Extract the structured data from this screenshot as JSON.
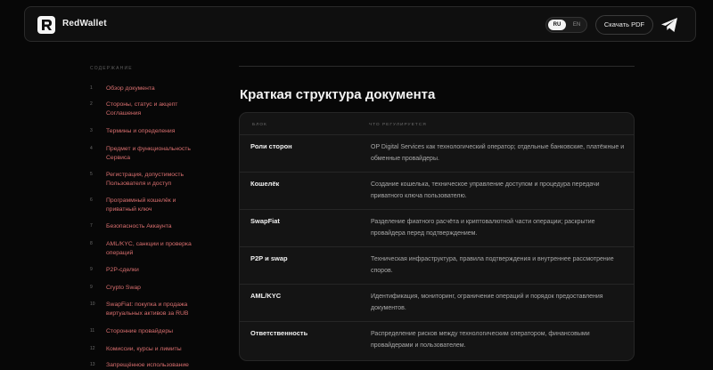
{
  "header": {
    "brand": "RedWallet",
    "lang_ru": "RU",
    "lang_en": "EN",
    "pdf_label": "Скачать PDF"
  },
  "sidebar": {
    "title": "СОДЕРЖАНИЕ",
    "items": [
      {
        "num": "1",
        "label": "Обзор документа"
      },
      {
        "num": "2",
        "label": "Стороны, статус и акцепт Соглашения"
      },
      {
        "num": "3",
        "label": "Термины и определения"
      },
      {
        "num": "4",
        "label": "Предмет и функциональность Сервиса"
      },
      {
        "num": "5",
        "label": "Регистрация, допустимость Пользователя и доступ"
      },
      {
        "num": "6",
        "label": "Программный кошелёк и приватный ключ"
      },
      {
        "num": "7",
        "label": "Безопасность Аккаунта"
      },
      {
        "num": "8",
        "label": "AML/KYC, санкции и проверка операций"
      },
      {
        "num": "9",
        "label": "P2P-сделки"
      },
      {
        "num": "9",
        "label": "Crypto Swap"
      },
      {
        "num": "10",
        "label": "SwapFiat: покупка и продажа виртуальных активов за RUB"
      },
      {
        "num": "11",
        "label": "Сторонние провайдеры"
      },
      {
        "num": "12",
        "label": "Комиссии, курсы и лимиты"
      },
      {
        "num": "13",
        "label": "Запрещённое использование"
      }
    ]
  },
  "main": {
    "title": "Краткая структура документа",
    "table": {
      "headers": [
        "БЛОК",
        "ЧТО РЕГУЛИРУЕТСЯ"
      ],
      "rows": [
        {
          "block": "Роли сторон",
          "desc": "OP Digital Services как технологический оператор; отдельные банковские, платёжные и обменные провайдеры."
        },
        {
          "block": "Кошелёк",
          "desc": "Создание кошелька, техническое управление доступом и процедура передачи приватного ключа пользователю."
        },
        {
          "block": "SwapFiat",
          "desc": "Разделение фиатного расчёта и криптовалютной части операции; раскрытие провайдера перед подтверждением."
        },
        {
          "block": "P2P и swap",
          "desc": "Техническая инфраструктура, правила подтверждения и внутреннее рассмотрение споров."
        },
        {
          "block": "AML/KYC",
          "desc": "Идентификация, мониторинг, ограничение операций и порядок предоставления документов."
        },
        {
          "block": "Ответственность",
          "desc": "Распределение рисков между технологическим оператором, финансовыми провайдерами и пользователем."
        }
      ]
    }
  }
}
